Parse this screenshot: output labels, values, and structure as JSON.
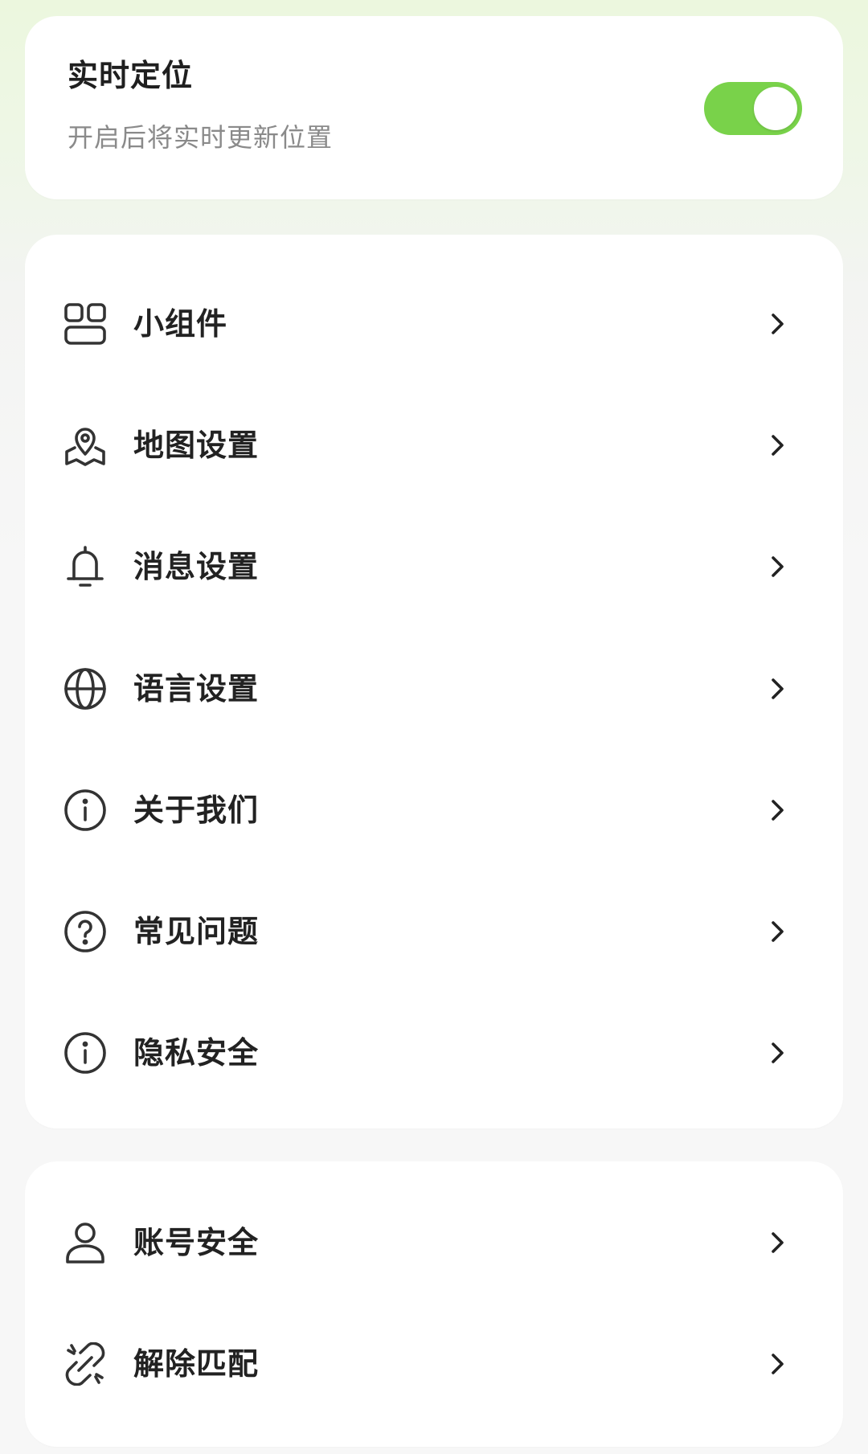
{
  "location": {
    "title": "实时定位",
    "subtitle": "开启后将实时更新位置",
    "toggle_on": true,
    "toggle_color": "#79d24a"
  },
  "menu": {
    "items": [
      {
        "label": "小组件",
        "icon": "widget-icon"
      },
      {
        "label": "地图设置",
        "icon": "map-pin-icon"
      },
      {
        "label": "消息设置",
        "icon": "bell-icon"
      },
      {
        "label": "语言设置",
        "icon": "globe-icon"
      },
      {
        "label": "关于我们",
        "icon": "info-icon"
      },
      {
        "label": "常见问题",
        "icon": "question-icon"
      },
      {
        "label": "隐私安全",
        "icon": "info-icon"
      }
    ]
  },
  "account": {
    "items": [
      {
        "label": "账号安全",
        "icon": "user-icon"
      },
      {
        "label": "解除匹配",
        "icon": "unlink-icon"
      }
    ]
  }
}
